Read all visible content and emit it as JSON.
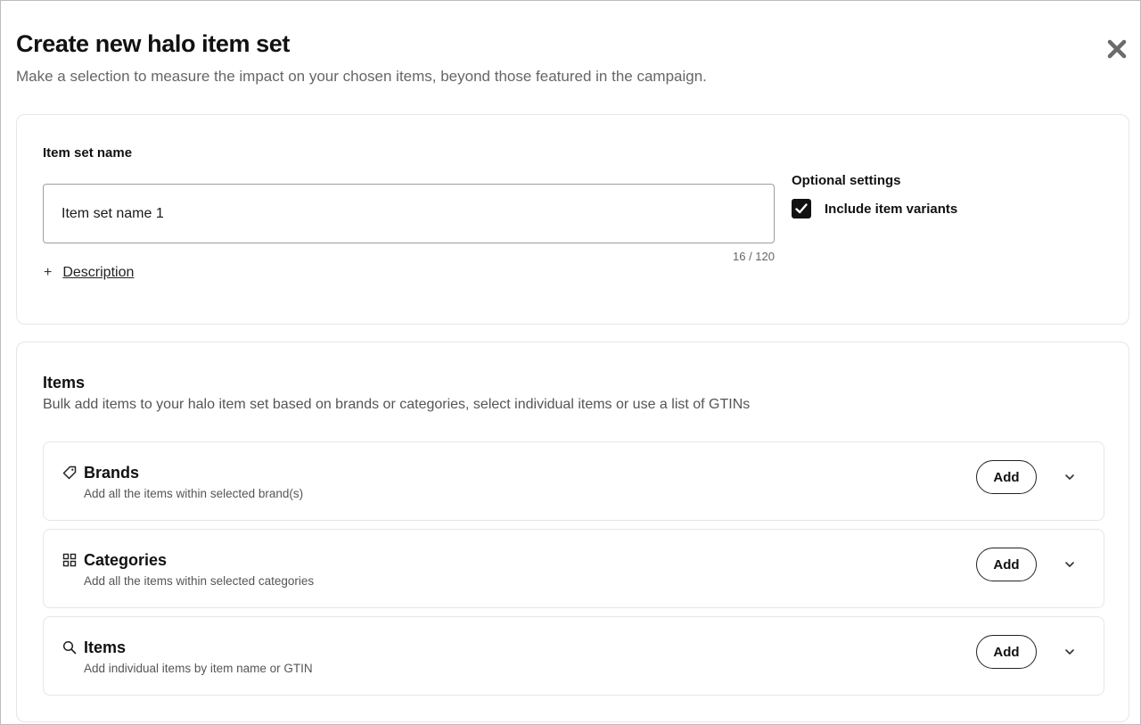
{
  "header": {
    "title": "Create new halo item set",
    "subtitle": "Make a selection to measure the impact on your chosen items, beyond those featured in the campaign.",
    "close_icon": "close-icon"
  },
  "item_set": {
    "label": "Item set name",
    "value": "Item set name 1",
    "char_count": "16 / 120",
    "description_link": "Description",
    "add_icon": "+"
  },
  "optional_settings": {
    "title": "Optional settings",
    "include_variants_label": "Include item variants",
    "include_variants_checked": true
  },
  "items_section": {
    "title": "Items",
    "description": "Bulk add items to your halo item set based on brands or categories, select individual items or use a list of GTINs",
    "rows": [
      {
        "icon": "tag-icon",
        "title": "Brands",
        "subtitle": "Add all the items within selected brand(s)",
        "add_label": "Add"
      },
      {
        "icon": "grid-icon",
        "title": "Categories",
        "subtitle": "Add all the items within selected categories",
        "add_label": "Add"
      },
      {
        "icon": "search-icon",
        "title": "Items",
        "subtitle": "Add individual items by item name or GTIN",
        "add_label": "Add"
      }
    ]
  },
  "colors": {
    "primary_text": "#111111",
    "secondary_text": "#666666",
    "border": "#e6e6e6",
    "checkbox": "#111111"
  }
}
